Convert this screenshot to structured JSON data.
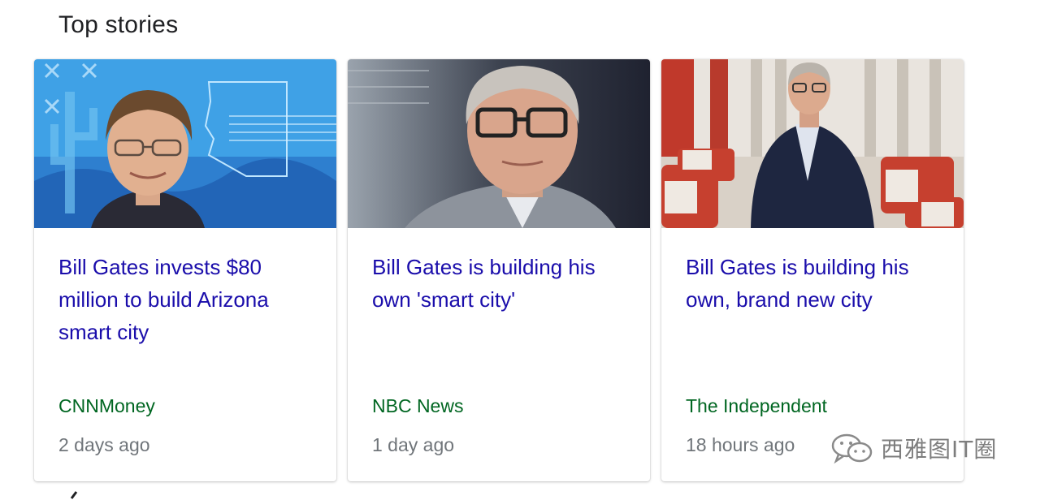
{
  "section": {
    "title": "Top stories"
  },
  "stories": [
    {
      "headline": "Bill Gates invests $80 million to build Arizona smart city",
      "source": "CNNMoney",
      "time": "2 days ago",
      "thumbnail_icon": "bill-gates-arizona-map-photo"
    },
    {
      "headline": "Bill Gates is building his own 'smart city'",
      "source": "NBC News",
      "time": "1 day ago",
      "thumbnail_icon": "bill-gates-portrait-photo"
    },
    {
      "headline": "Bill Gates is building his own, brand new city",
      "source": "The Independent",
      "time": "18 hours ago",
      "thumbnail_icon": "bill-gates-standing-room-photo"
    }
  ],
  "watermark": {
    "text": "西雅图IT圈",
    "icon": "wechat-icon"
  },
  "colors": {
    "headline": "#1a0dab",
    "source": "#006621",
    "time": "#70757a"
  }
}
